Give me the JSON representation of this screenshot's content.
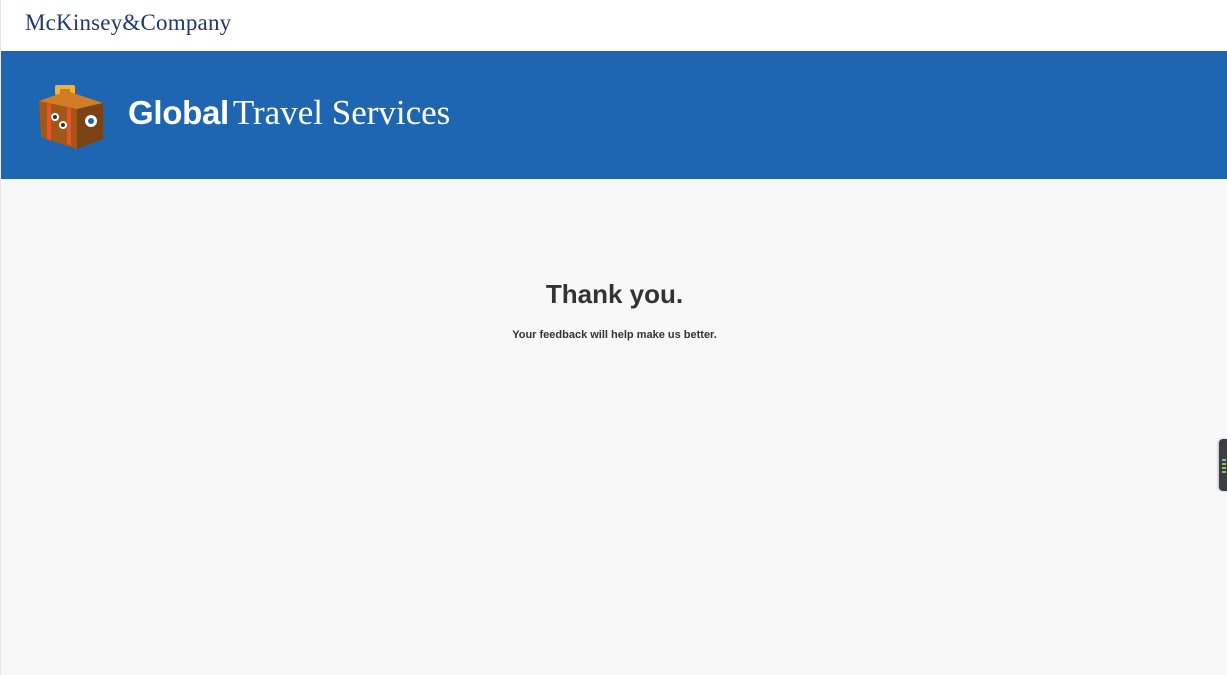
{
  "header": {
    "brand": "McKinsey&Company"
  },
  "banner": {
    "title_bold": "Global",
    "title_light": "Travel Services",
    "icon": "suitcase-icon"
  },
  "main": {
    "title": "Thank you.",
    "subtitle": "Your feedback will help make us better."
  },
  "colors": {
    "banner": "#1e66b2",
    "brand_text": "#1f3a68",
    "page_bg": "#f8f8f8",
    "text": "#333333"
  }
}
